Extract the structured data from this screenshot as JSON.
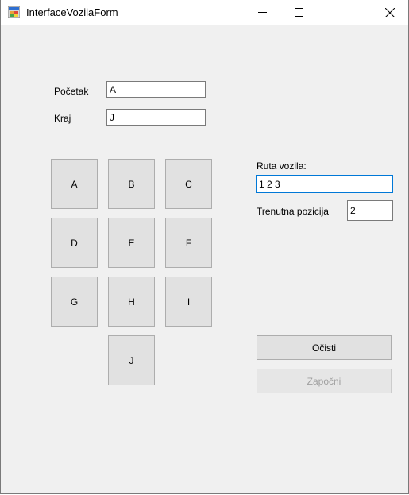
{
  "window": {
    "title": "InterfaceVozilaForm",
    "icon": "winforms-app-icon",
    "controls": {
      "minimize": "minimize-icon",
      "maximize": "maximize-icon",
      "close": "close-icon"
    }
  },
  "form": {
    "start_label": "Početak",
    "start_value": "A",
    "end_label": "Kraj",
    "end_value": "J",
    "grid_buttons": [
      "A",
      "B",
      "C",
      "D",
      "E",
      "F",
      "G",
      "H",
      "I",
      "J"
    ],
    "route_label": "Ruta vozila:",
    "route_value": "1 2 3",
    "position_label": "Trenutna pozicija",
    "position_value": "2",
    "clear_button": "Očisti",
    "start_button": "Započni",
    "start_button_enabled": false
  },
  "colors": {
    "window_bg": "#f0f0f0",
    "button_bg": "#e1e1e1",
    "focus_border": "#0078d7",
    "disabled_text": "#a0a0a0"
  }
}
